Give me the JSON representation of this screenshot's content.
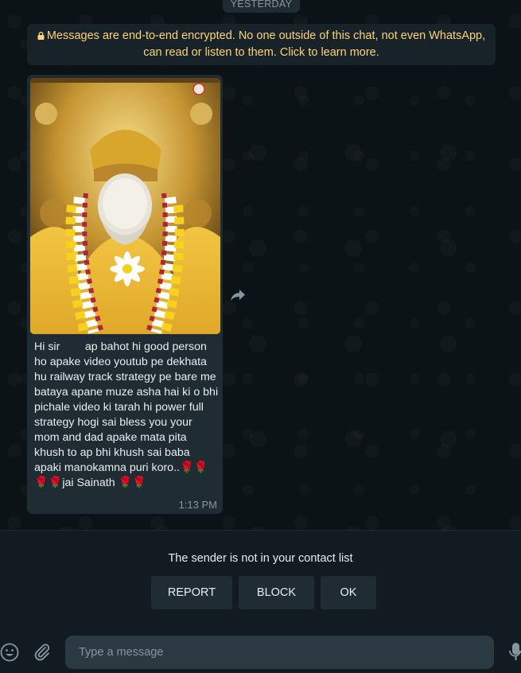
{
  "chat": {
    "date_chip": "YESTERDAY",
    "encryption_notice": "Messages are end-to-end encrypted. No one outside of this chat, not even WhatsApp, can read or listen to them. Click to learn more.",
    "message": {
      "text": "Hi sir        ap bahot hi good person ho apake video youtub pe dekhata hu railway track strategy pe bare me bataya apane muze asha hai ki o bhi pichale video ki tarah hi power full strategy hogi sai bless you your mom and dad apake mata pita khush to ap bhi khush sai baba apaki manokamna puri koro..🌹🌹🌹🌹jai Sainath 🌹🌹",
      "time": "1:13 PM",
      "image_icon": "sai-baba-photo"
    },
    "forward_icon": "forward-arrow-icon"
  },
  "contact_panel": {
    "notice": "The sender is not in your contact list",
    "report_label": "REPORT",
    "block_label": "BLOCK",
    "ok_label": "OK"
  },
  "compose": {
    "placeholder": "Type a message",
    "emoji_icon": "emoji-icon",
    "attach_icon": "paperclip-icon",
    "mic_icon": "microphone-icon"
  },
  "colors": {
    "background": "#0b141a",
    "bubble": "#202c33",
    "notice_text": "#ffd279",
    "input": "#2a3942"
  }
}
